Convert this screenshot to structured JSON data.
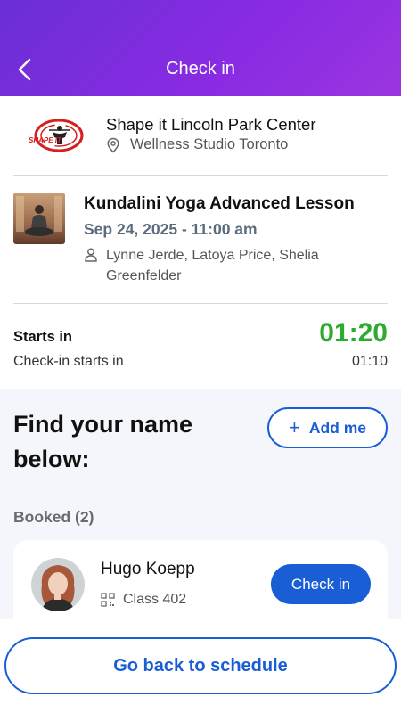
{
  "header": {
    "title": "Check in",
    "back_icon": "chevron-left-icon"
  },
  "venue": {
    "name": "Shape it Lincoln Park Center",
    "location": "Wellness Studio Toronto",
    "logo_text": "SHAPE IT"
  },
  "lesson": {
    "title": "Kundalini Yoga Advanced Lesson",
    "datetime": "Sep 24, 2025 - 11:00 am",
    "instructors": "Lynne Jerde, Latoya Price, Shelia Greenfelder"
  },
  "timer": {
    "starts_label": "Starts in",
    "starts_value": "01:20",
    "checkin_label": "Check-in starts in",
    "checkin_value": "01:10"
  },
  "booking": {
    "find_title": "Find your name below:",
    "add_me_label": "Add me",
    "booked_label": "Booked (2)",
    "attendee": {
      "name": "Hugo Koepp",
      "class": "Class 402",
      "checkin_label": "Check in"
    }
  },
  "footer": {
    "go_back_label": "Go back to schedule"
  },
  "colors": {
    "header_gradient_start": "#6a2fd6",
    "header_gradient_end": "#9b35e0",
    "primary_blue": "#1a5ed6",
    "timer_green": "#2eaa2e",
    "panel_bg": "#f4f6fc"
  }
}
